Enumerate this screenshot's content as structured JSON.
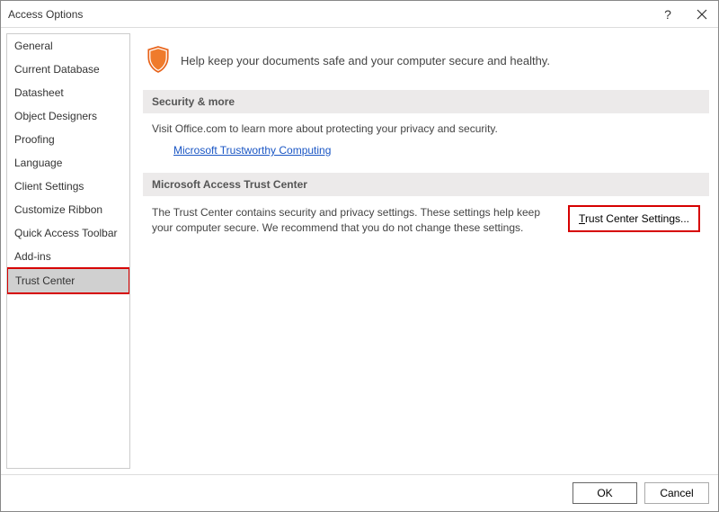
{
  "window": {
    "title": "Access Options"
  },
  "sidebar": {
    "items": [
      {
        "label": "General"
      },
      {
        "label": "Current Database"
      },
      {
        "label": "Datasheet"
      },
      {
        "label": "Object Designers"
      },
      {
        "label": "Proofing"
      },
      {
        "label": "Language"
      },
      {
        "label": "Client Settings"
      },
      {
        "label": "Customize Ribbon"
      },
      {
        "label": "Quick Access Toolbar"
      },
      {
        "label": "Add-ins"
      },
      {
        "label": "Trust Center"
      }
    ],
    "selected_index": 10
  },
  "banner": {
    "text": "Help keep your documents safe and your computer secure and healthy."
  },
  "sections": {
    "security": {
      "header": "Security & more",
      "desc": "Visit Office.com to learn more about protecting your privacy and security.",
      "link": "Microsoft Trustworthy Computing"
    },
    "trust_center": {
      "header": "Microsoft Access Trust Center",
      "desc": "The Trust Center contains security and privacy settings. These settings help keep your computer secure. We recommend that you do not change these settings.",
      "button_prefix": "T",
      "button_suffix": "rust Center Settings..."
    }
  },
  "footer": {
    "ok": "OK",
    "cancel": "Cancel"
  }
}
